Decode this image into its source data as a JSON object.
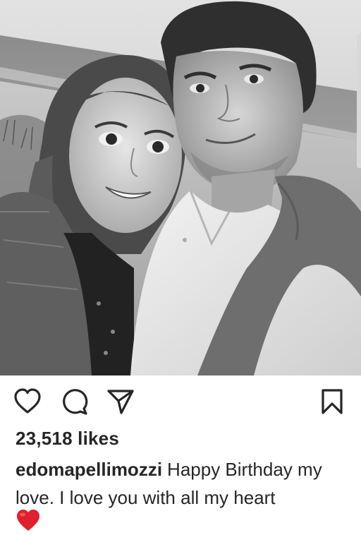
{
  "post": {
    "image_alt": "Black and white selfie of a couple at the beach",
    "likes_text": "23,518 likes",
    "author": "edomapellimozzi",
    "caption_text": "Happy Birthday my love. I love you with all my heart",
    "emoji": "red-heart"
  },
  "actions": {
    "like_icon": "heart-outline-icon",
    "comment_icon": "comment-bubble-icon",
    "share_icon": "paper-plane-icon",
    "save_icon": "bookmark-icon"
  },
  "colors": {
    "text": "#262626",
    "emoji_heart": "#e0202c",
    "background": "#ffffff"
  }
}
